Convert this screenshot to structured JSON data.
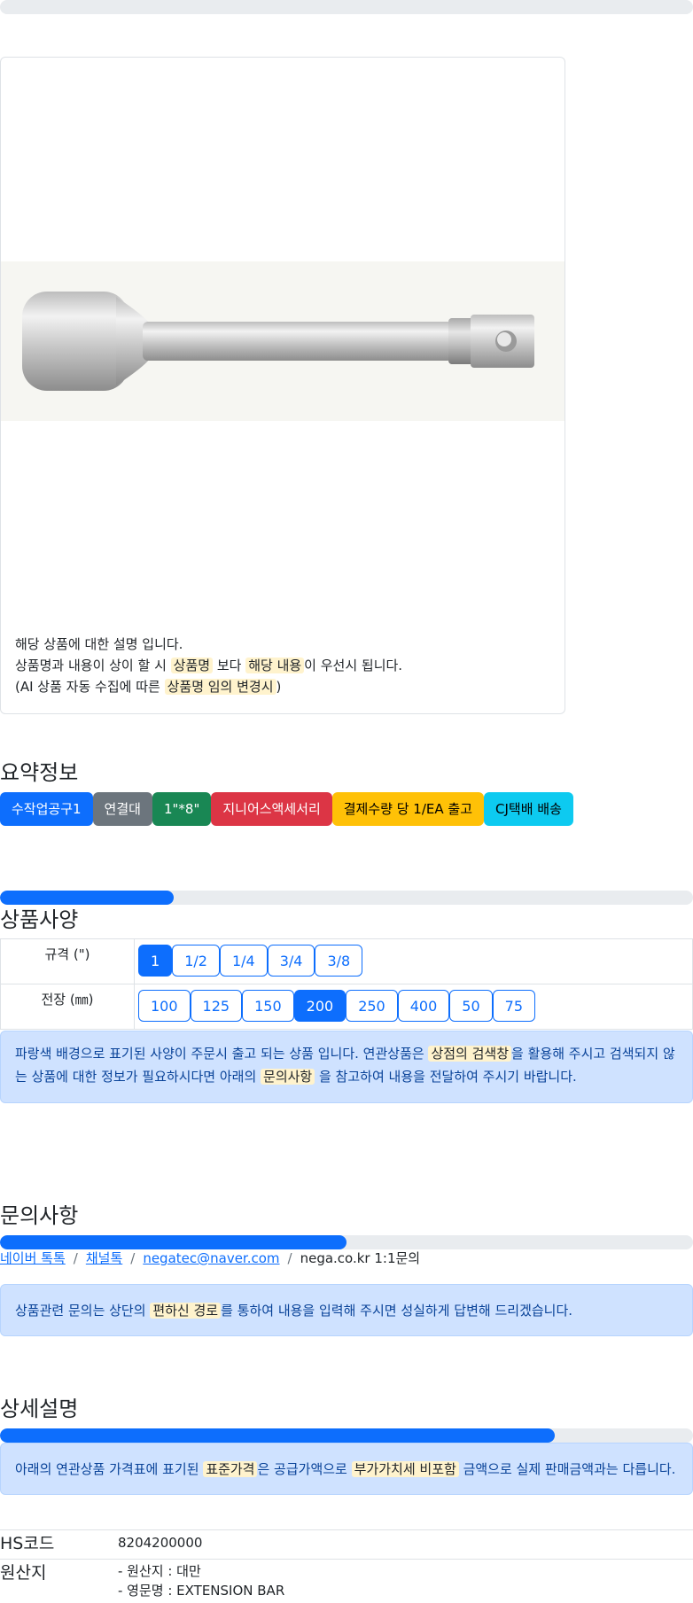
{
  "product": {
    "image_alt": "extension bar",
    "desc_line1": "해당 상품에 대한 설명 입니다.",
    "desc_line2_a": "상품명과 내용이 상이 할 시 ",
    "desc_line2_mark1": "상품명",
    "desc_line2_b": " 보다 ",
    "desc_line2_mark2": "해당 내용",
    "desc_line2_c": "이 우선시 됩니다.",
    "desc_line3_a": "(AI 상품 자동 수집에 따른 ",
    "desc_line3_mark": "상품명 임의 변경시",
    "desc_line3_b": ")"
  },
  "summary": {
    "title": "요약정보",
    "badges": [
      {
        "label": "수작업공구1",
        "color": "#0d6efd",
        "text": "#ffffff"
      },
      {
        "label": "연결대",
        "color": "#6c757d",
        "text": "#ffffff"
      },
      {
        "label": "1\"*8\"",
        "color": "#198754",
        "text": "#ffffff"
      },
      {
        "label": "지니어스액세서리",
        "color": "#dc3545",
        "text": "#ffffff"
      },
      {
        "label": "결제수량 당 1/EA 출고",
        "color": "#ffc107",
        "text": "#000000"
      },
      {
        "label": "CJ택배 배송",
        "color": "#0dcaf0",
        "text": "#000000"
      }
    ]
  },
  "spec": {
    "progress": 0.25,
    "title": "상품사양",
    "rows": [
      {
        "label": "규격 (\")",
        "options": [
          "1",
          "1/2",
          "1/4",
          "3/4",
          "3/8"
        ],
        "selected": "1"
      },
      {
        "label": "전장 (㎜)",
        "options": [
          "100",
          "125",
          "150",
          "200",
          "250",
          "400",
          "50",
          "75"
        ],
        "selected": "200"
      }
    ],
    "notice_a": "파랑색 배경으로 표기된 사양이 주문시 출고 되는 상품 입니다. 연관상품은 ",
    "notice_mark1": "상점의 검색창",
    "notice_b": "을 활용해 주시고 검색되지 않는 상품에 대한 정보가 필요하시다면 아래의 ",
    "notice_mark2": "문의사항",
    "notice_c": " 을 참고하여 내용을 전달하여 주시기 바랍니다."
  },
  "inquiry": {
    "title": "문의사항",
    "progress": 0.5,
    "links": [
      "네이버 톡톡",
      "채널톡",
      "negatec@naver.com"
    ],
    "plain": "nega.co.kr 1:1문의",
    "notice_a": "상품관련 문의는 상단의 ",
    "notice_mark": "편하신 경로",
    "notice_b": "를 통하여 내용을 입력해 주시면 성실하게 답변해 드리겠습니다."
  },
  "detail": {
    "title": "상세설명",
    "progress": 0.8,
    "notice_a": "아래의 연관상품 가격표에 표기된 ",
    "notice_mark1": "표준가격",
    "notice_b": "은 공급가액으로 ",
    "notice_mark2": "부가가치세 비포함",
    "notice_c": " 금액으로 실제 판매금액과는 다릅니다.",
    "hs_label": "HS코드",
    "hs_value": "8204200000",
    "origin_label": "원산지",
    "origin_line1": "- 원산지 : 대만",
    "origin_line2": "- 영문명 : EXTENSION BAR"
  }
}
